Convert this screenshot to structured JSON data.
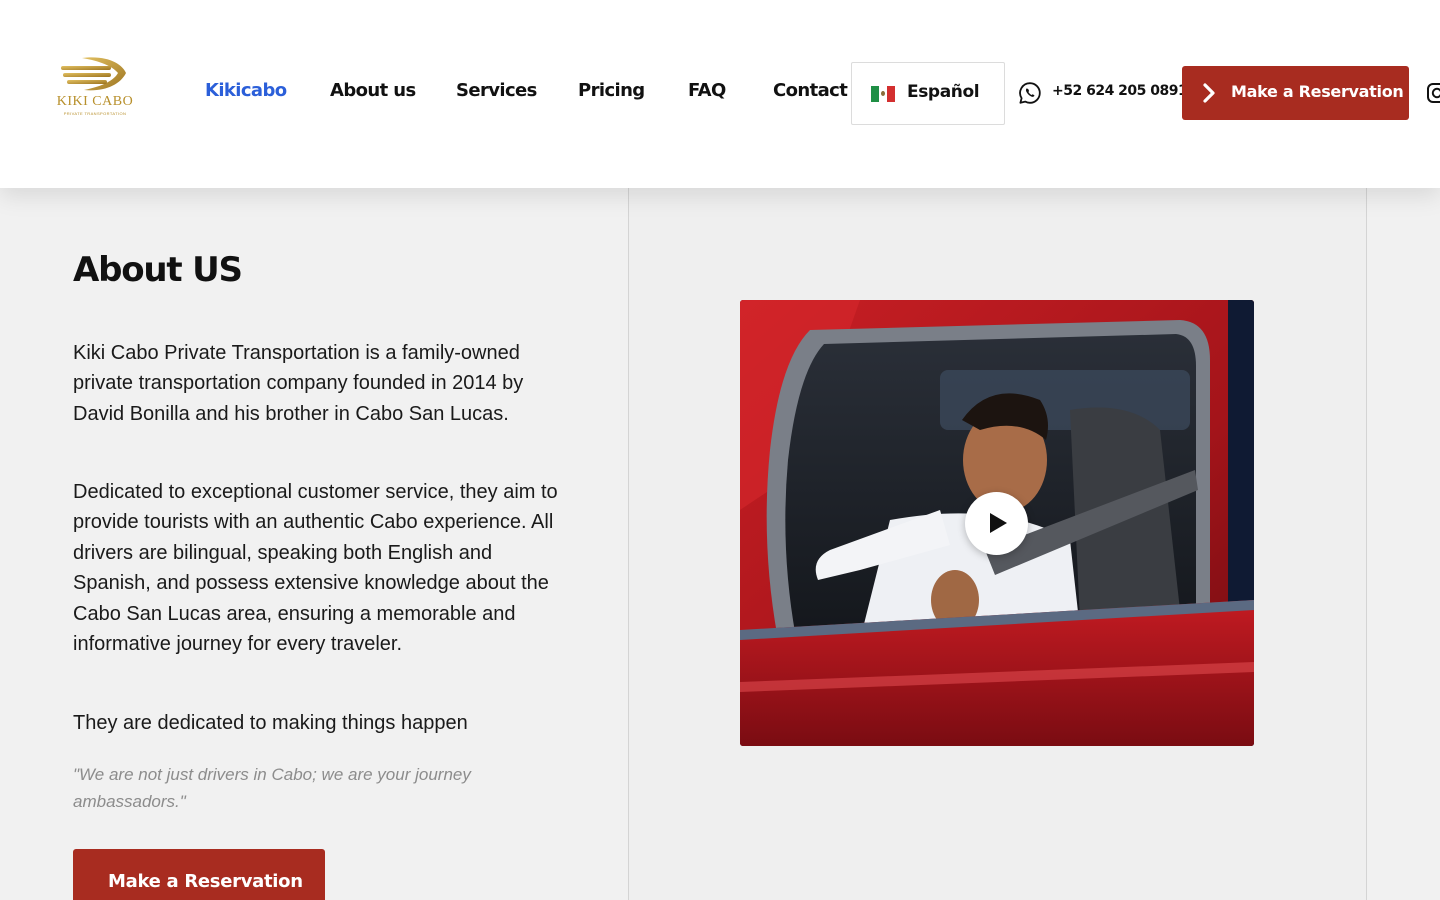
{
  "header": {
    "logo": {
      "text": "KIKI CABO",
      "subtext": "PRIVATE TRANSPORTATION"
    },
    "nav": [
      {
        "label": "Kikicabo",
        "active": true
      },
      {
        "label": "About us",
        "active": false
      },
      {
        "label": "Services",
        "active": false
      },
      {
        "label": "Pricing",
        "active": false
      },
      {
        "label": "FAQ",
        "active": false
      },
      {
        "label": "Contact us",
        "active": false
      }
    ],
    "language": {
      "label": "Español",
      "flag": "mexico-flag-icon"
    },
    "phone": {
      "icon": "whatsapp-icon",
      "number": "+52 624 205 0891"
    },
    "reserve_button": {
      "label": "Make a Reservation",
      "icon": "chevron-right-icon"
    },
    "social_icon": "instagram-icon"
  },
  "about": {
    "title": "About US",
    "paragraphs": [
      "Kiki Cabo Private Transportation is a family-owned private transportation company founded in 2014 by David Bonilla and his brother in Cabo San Lucas.",
      "Dedicated to exceptional customer service, they aim to provide tourists with an authentic Cabo experience. All drivers are bilingual, speaking both English and Spanish, and possess extensive knowledge about the Cabo San Lucas area, ensuring a memorable and informative journey for every traveler.",
      "They are dedicated to making things happen"
    ],
    "quote": "\"We are not just drivers in Cabo; we are your journey ambassadors.\"",
    "cta_label": "Make a Reservation"
  },
  "video": {
    "play_icon": "play-icon"
  },
  "colors": {
    "accent_red": "#a82c20",
    "active_nav": "#2b5fd9",
    "logo_gold": "#b8902c"
  }
}
